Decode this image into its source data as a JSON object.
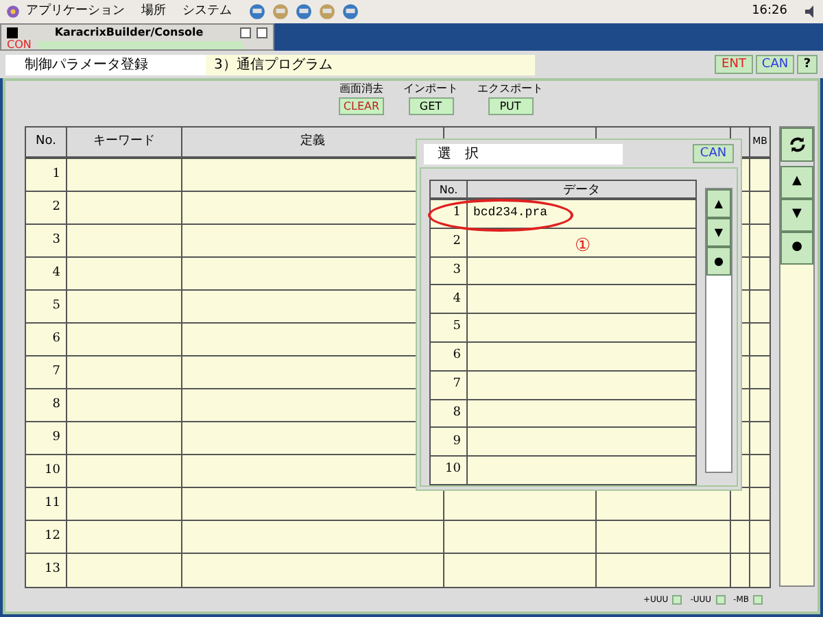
{
  "menu_bar": {
    "items": [
      "アプリケーション",
      "場所",
      "システム"
    ],
    "clock": "16:26"
  },
  "console_window": {
    "title": "KaracrixBuilder/Console",
    "label": "CON"
  },
  "header": {
    "screen_name": "制御パラメータ登録",
    "program": "3）通信プログラム",
    "buttons": [
      {
        "label": "ENT",
        "color": "#e02020"
      },
      {
        "label": "CAN",
        "color": "#2a3ae0"
      },
      {
        "label": "?",
        "color": "#000000"
      }
    ]
  },
  "actions": [
    {
      "caption": "画面消去",
      "label": "CLEAR",
      "color": "#c02020"
    },
    {
      "caption": "インポート",
      "label": "GET",
      "color": "#000000"
    },
    {
      "caption": "エクスポート",
      "label": "PUT",
      "color": "#000000"
    }
  ],
  "table": {
    "columns": [
      "No.",
      "キーワード",
      "定義",
      "MB"
    ],
    "rows": [
      "1",
      "2",
      "3",
      "4",
      "5",
      "6",
      "7",
      "8",
      "9",
      "10",
      "11",
      "12",
      "13"
    ]
  },
  "side_buttons": [
    "▲",
    "▼",
    "●"
  ],
  "dialog": {
    "title": "選　択",
    "cancel": "CAN",
    "columns": [
      "No.",
      "データ"
    ],
    "rows": [
      {
        "no": "1",
        "data": "bcd234.pra"
      },
      {
        "no": "2"
      },
      {
        "no": "3"
      },
      {
        "no": "4"
      },
      {
        "no": "5"
      },
      {
        "no": "6"
      },
      {
        "no": "7"
      },
      {
        "no": "8"
      },
      {
        "no": "9"
      },
      {
        "no": "10"
      }
    ],
    "scroll_buttons": [
      "▲",
      "▼",
      "●"
    ],
    "annotation": "①"
  },
  "footer": [
    "+UUU",
    "-UUU",
    "-MB"
  ]
}
